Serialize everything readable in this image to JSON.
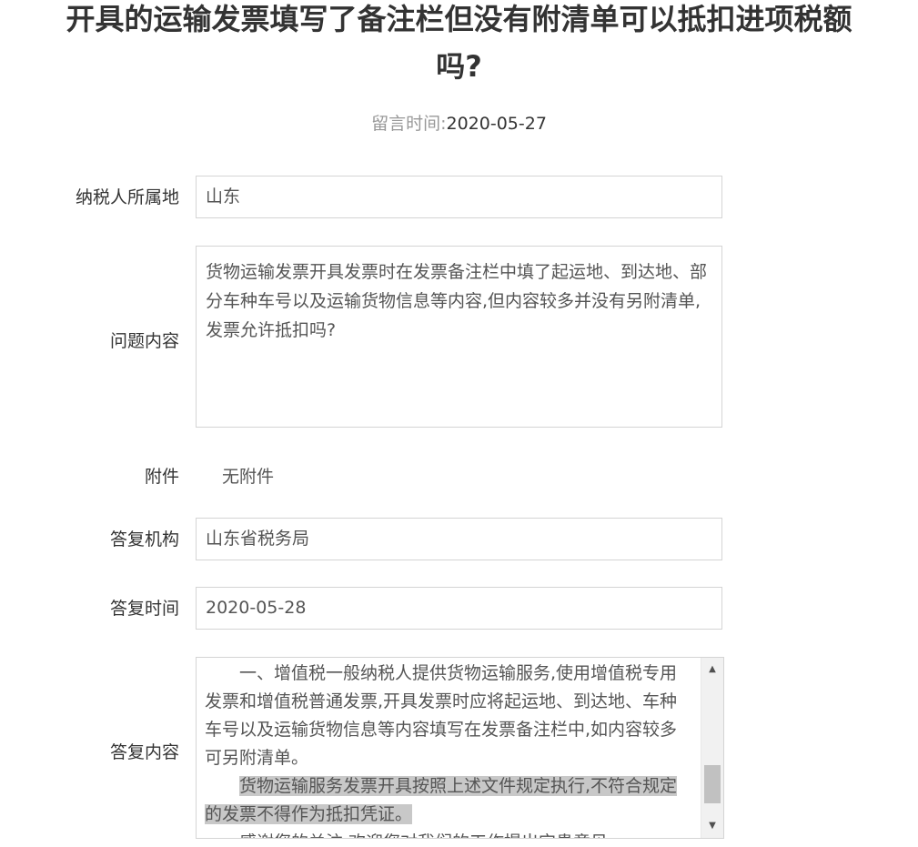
{
  "title_line1": "开具的运输发票填写了备注栏但没有附清单可以抵扣进项税额",
  "title_line2": "吗?",
  "meta": {
    "label": "留言时间:",
    "value": "2020-05-27"
  },
  "fields": {
    "taxpayer_location": {
      "label": "纳税人所属地",
      "value": "山东"
    },
    "question": {
      "label": "问题内容",
      "value": "货物运输发票开具发票时在发票备注栏中填了起运地、到达地、部分车种车号以及运输货物信息等内容,但内容较多并没有另附清单,发票允许抵扣吗?"
    },
    "attachment": {
      "label": "附件",
      "value": "无附件"
    },
    "reply_org": {
      "label": "答复机构",
      "value": "山东省税务局"
    },
    "reply_time": {
      "label": "答复时间",
      "value": "2020-05-28"
    },
    "reply_content": {
      "label": "答复内容",
      "para1": "一、增值税一般纳税人提供货物运输服务,使用增值税专用发票和增值税普通发票,开具发票时应将起运地、到达地、车种车号以及运输货物信息等内容填写在发票备注栏中,如内容较多可另附清单。",
      "para2": "货物运输服务发票开具按照上述文件规定执行,不符合规定的发票不得作为抵扣凭证。",
      "para3_partial": "感谢您的关注,欢迎您对我们的工作提出宝贵意见。"
    }
  },
  "scrollbar": {
    "up_icon": "▲",
    "down_icon": "▼"
  }
}
